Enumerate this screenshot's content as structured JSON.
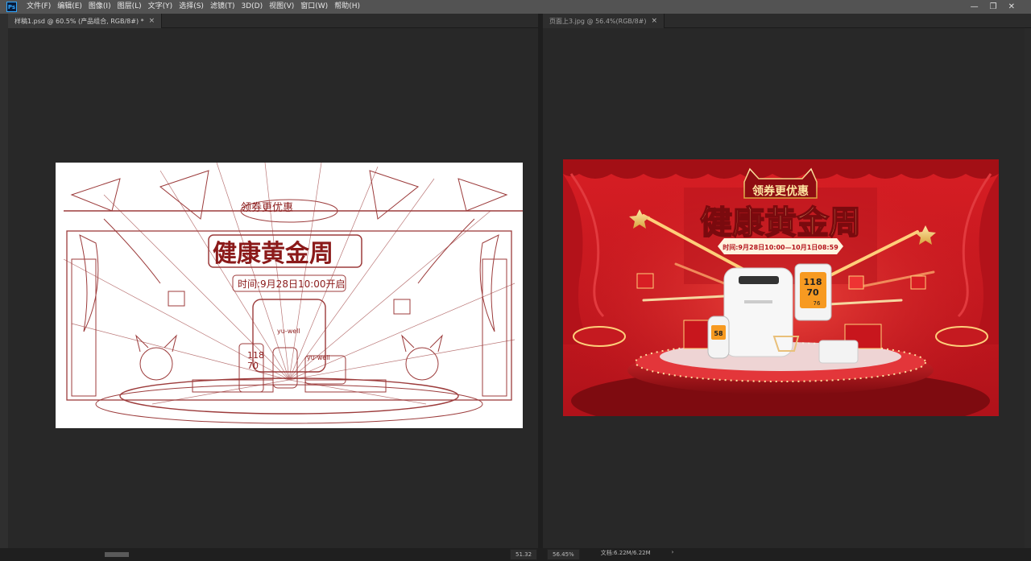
{
  "app": {
    "logo": "Ps",
    "menu": [
      "文件(F)",
      "编辑(E)",
      "图像(I)",
      "图层(L)",
      "文字(Y)",
      "选择(S)",
      "滤镜(T)",
      "3D(D)",
      "视图(V)",
      "窗口(W)",
      "帮助(H)"
    ]
  },
  "tabs_left": [
    {
      "label": "样稿1.psd @ 60.5% (产品组合, RGB/8#) *",
      "close": "×"
    }
  ],
  "tabs_right": [
    {
      "label": "页面上3.jpg @ 56.4%(RGB/8#)",
      "close": "×"
    }
  ],
  "sketch": {
    "badge": "领券更优惠",
    "title": "健康黄金周",
    "time": "时间:9月28日10:00开启",
    "lcd_top": "118",
    "lcd_bottom": "70",
    "label_a": "yu-well",
    "label_b": "yu-well"
  },
  "banner": {
    "badge": "领券更优惠",
    "title": "健康黄金周",
    "time": "时间:9月28日10:00—10月1日08:59",
    "device_display": "118",
    "device_display2": "70",
    "device_display3": "76",
    "meter_value": "58",
    "colors": {
      "bg_red": "#c8161d",
      "deep_red": "#8e0d12",
      "gold": "#f2c86b",
      "white": "#f5f5f5"
    }
  },
  "status": {
    "left_zoom": "51.32",
    "right_zoom": "56.45%",
    "doc_size": "文档:6.22M/6.22M",
    "arrow": "›"
  },
  "window_controls": [
    "—",
    "❐",
    "✕"
  ]
}
